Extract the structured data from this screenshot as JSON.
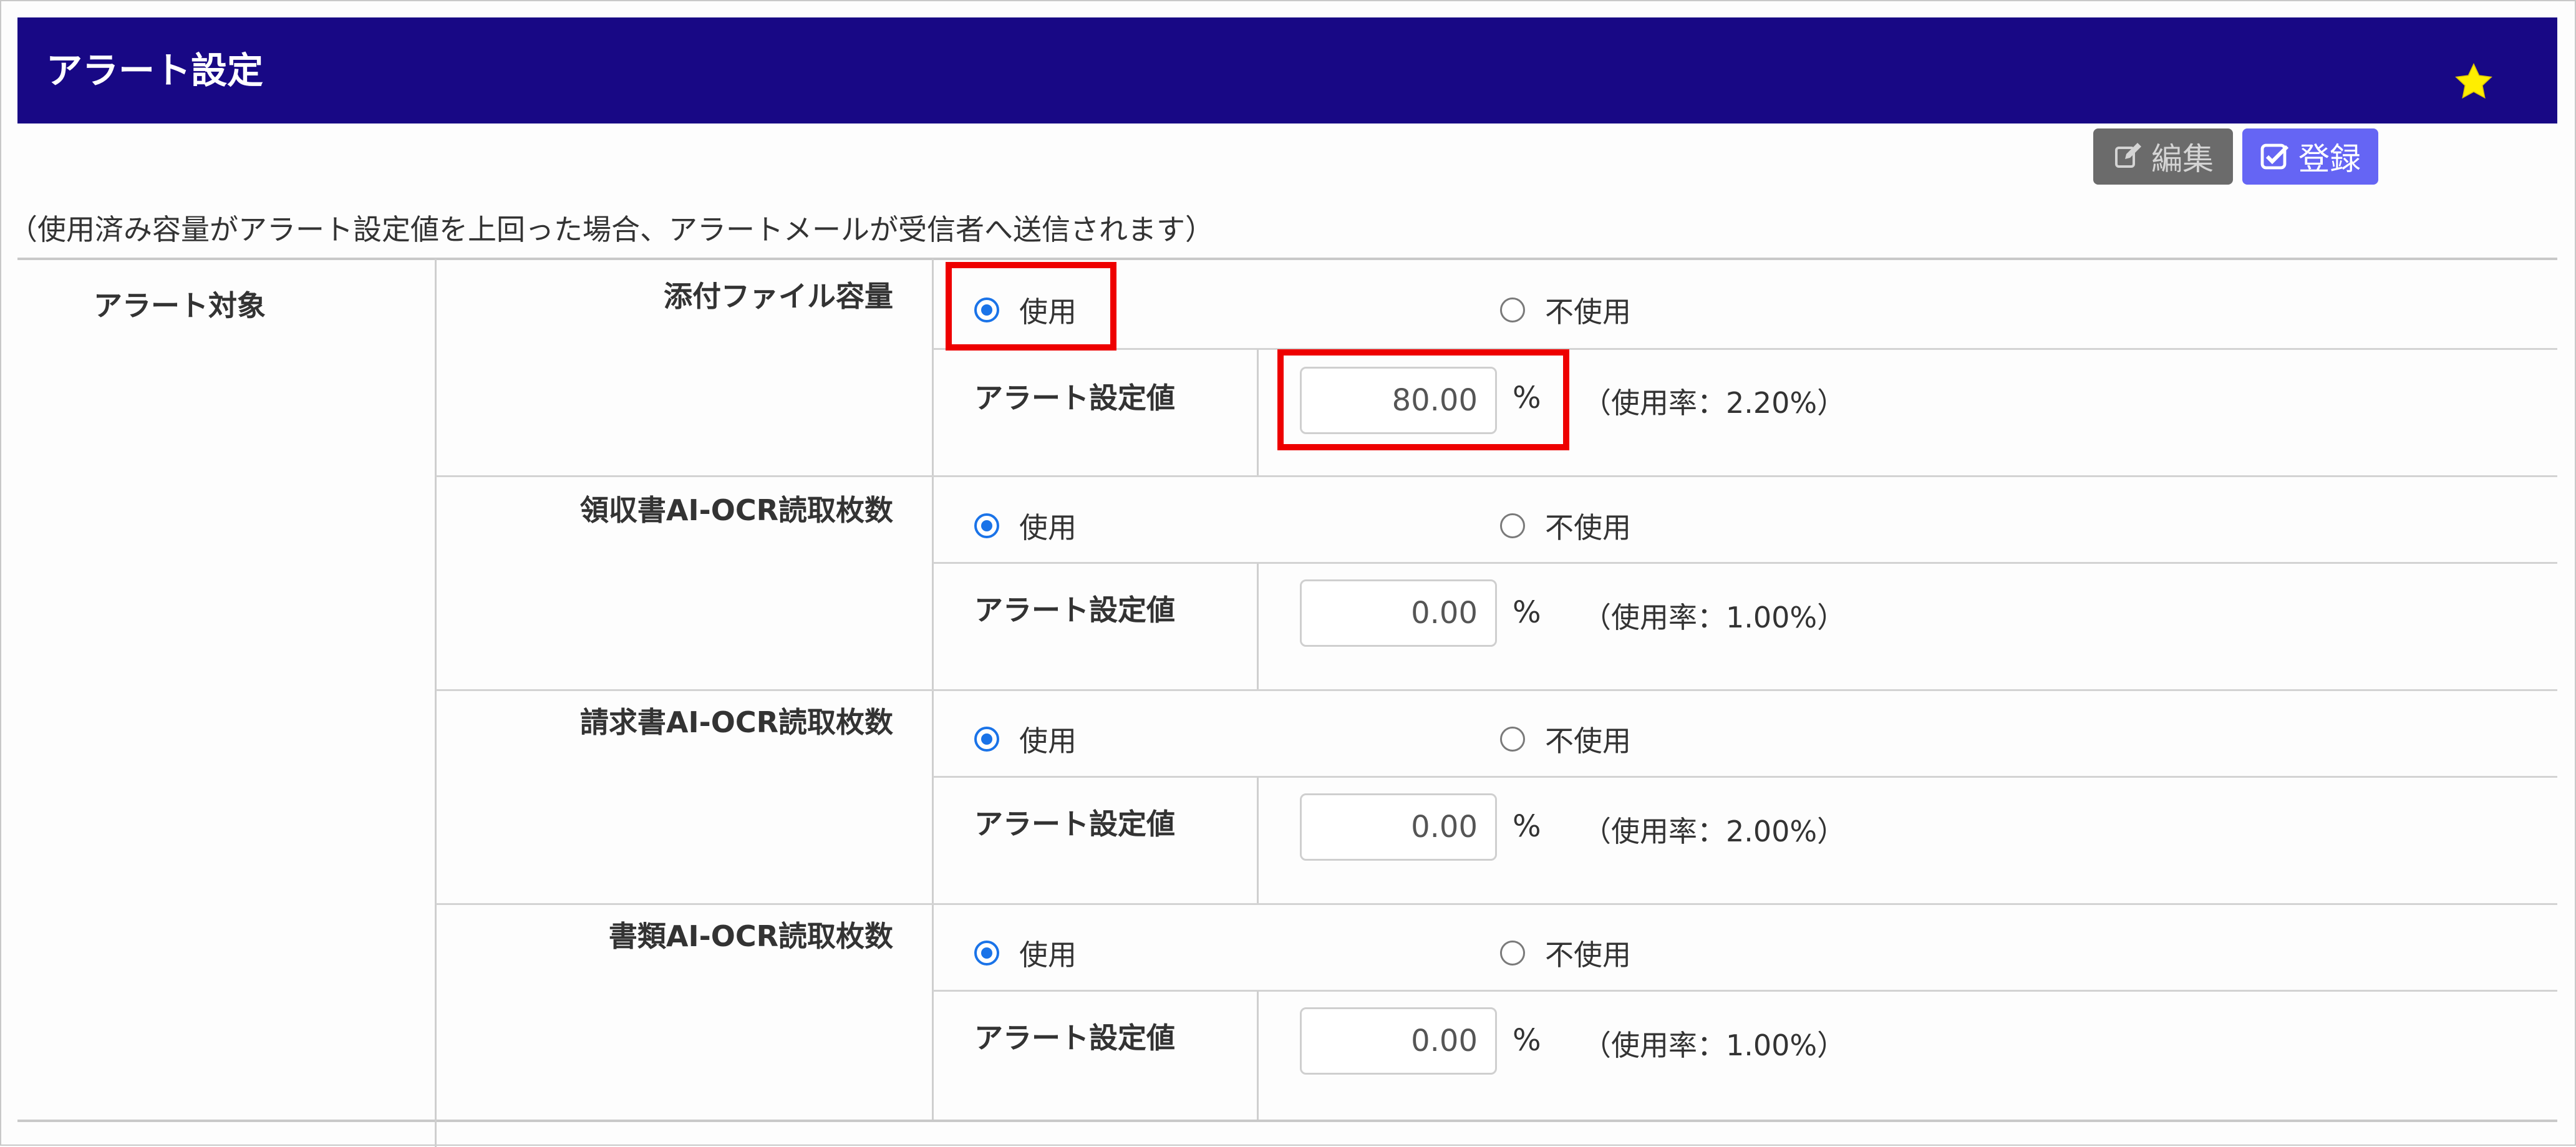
{
  "header": {
    "title": "アラート設定",
    "favorite_icon": "star-icon",
    "background": "#180885"
  },
  "toolbar": {
    "edit_label": "編集",
    "save_label": "登録"
  },
  "note": "（使用済み容量がアラート設定値を上回った場合、アラートメールが受信者へ送信されます）",
  "section_label": "アラート対象",
  "options": {
    "use": "使用",
    "not_use": "不使用"
  },
  "threshold_label": "アラート設定値",
  "percent_unit": "%",
  "items": [
    {
      "name": "添付ファイル容量",
      "selected": "使用",
      "value": "80.00",
      "usage": "（使用率：2.20%）"
    },
    {
      "name": "領収書AI-OCR読取枚数",
      "selected": "使用",
      "value": "0.00",
      "usage": "（使用率：1.00%）"
    },
    {
      "name": "請求書AI-OCR読取枚数",
      "selected": "使用",
      "value": "0.00",
      "usage": "（使用率：2.00%）"
    },
    {
      "name": "書類AI-OCR読取枚数",
      "selected": "使用",
      "value": "0.00",
      "usage": "（使用率：1.00%）"
    }
  ],
  "highlight_color": "#ee0000"
}
